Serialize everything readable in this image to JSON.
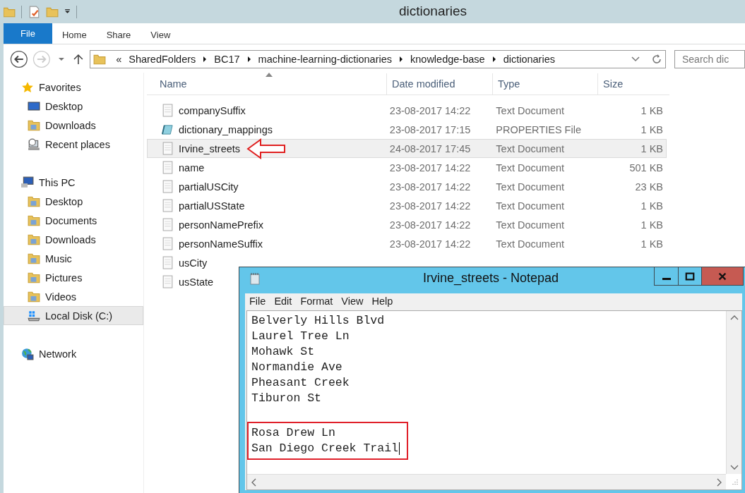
{
  "window": {
    "title": "dictionaries"
  },
  "quick_access": [
    {
      "kind": "folder"
    },
    {
      "kind": "properties"
    },
    {
      "kind": "folder"
    },
    {
      "kind": "dropdown"
    }
  ],
  "ribbon_tabs": [
    {
      "label": "File",
      "selected": true
    },
    {
      "label": "Home",
      "selected": false
    },
    {
      "label": "Share",
      "selected": false
    },
    {
      "label": "View",
      "selected": false
    }
  ],
  "address_bar": {
    "overflow": "«",
    "segments": [
      "SharedFolders",
      "BC17",
      "machine-learning-dictionaries",
      "knowledge-base",
      "dictionaries"
    ]
  },
  "search": {
    "placeholder": "Search dic"
  },
  "sidebar": {
    "items": [
      {
        "label": "Favorites",
        "kind": "star",
        "selected": false,
        "children": [
          {
            "label": "Desktop",
            "kind": "monitor",
            "selected": false
          },
          {
            "label": "Downloads",
            "kind": "folder",
            "selected": false
          },
          {
            "label": "Recent places",
            "kind": "recent",
            "selected": false
          }
        ]
      },
      {
        "label": "This PC",
        "kind": "computer",
        "selected": false,
        "children": [
          {
            "label": "Desktop",
            "kind": "folder",
            "selected": false
          },
          {
            "label": "Documents",
            "kind": "folder",
            "selected": false
          },
          {
            "label": "Downloads",
            "kind": "folder",
            "selected": false
          },
          {
            "label": "Music",
            "kind": "folder",
            "selected": false
          },
          {
            "label": "Pictures",
            "kind": "folder",
            "selected": false
          },
          {
            "label": "Videos",
            "kind": "folder",
            "selected": false
          },
          {
            "label": "Local Disk (C:)",
            "kind": "drive",
            "selected": true
          }
        ]
      },
      {
        "label": "Network",
        "kind": "globe",
        "selected": false
      }
    ]
  },
  "table": {
    "columns": [
      "Name",
      "Date modified",
      "Type",
      "Size"
    ],
    "rows": [
      {
        "kind": "text",
        "name": "companySuffix",
        "date": "23-08-2017 14:22",
        "type": "Text Document",
        "size": "1 KB",
        "selected": false
      },
      {
        "kind": "properties",
        "name": "dictionary_mappings",
        "date": "23-08-2017 17:15",
        "type": "PROPERTIES File",
        "size": "1 KB",
        "selected": false
      },
      {
        "kind": "text",
        "name": "Irvine_streets",
        "date": "24-08-2017 17:45",
        "type": "Text Document",
        "size": "1 KB",
        "selected": true,
        "pointer": true
      },
      {
        "kind": "text",
        "name": "name",
        "date": "23-08-2017 14:22",
        "type": "Text Document",
        "size": "501 KB",
        "selected": false
      },
      {
        "kind": "text",
        "name": "partialUSCity",
        "date": "23-08-2017 14:22",
        "type": "Text Document",
        "size": "23 KB",
        "selected": false
      },
      {
        "kind": "text",
        "name": "partialUSState",
        "date": "23-08-2017 14:22",
        "type": "Text Document",
        "size": "1 KB",
        "selected": false
      },
      {
        "kind": "text",
        "name": "personNamePrefix",
        "date": "23-08-2017 14:22",
        "type": "Text Document",
        "size": "1 KB",
        "selected": false
      },
      {
        "kind": "text",
        "name": "personNameSuffix",
        "date": "23-08-2017 14:22",
        "type": "Text Document",
        "size": "1 KB",
        "selected": false
      },
      {
        "kind": "text",
        "name": "usCity",
        "selected": false
      },
      {
        "kind": "text",
        "name": "usState",
        "selected": false
      }
    ]
  },
  "notepad": {
    "title": "Irvine_streets - Notepad",
    "menu": [
      "File",
      "Edit",
      "Format",
      "View",
      "Help"
    ],
    "blocks": [
      {
        "highlighted": false,
        "lines": [
          "Belverly Hills Blvd",
          "Laurel Tree Ln",
          "Mohawk St",
          "Normandie Ave",
          "Pheasant Creek",
          "Tiburon St"
        ]
      },
      {
        "highlighted": true,
        "lines": [
          "Rosa Drew Ln",
          "San Diego Creek Trail"
        ]
      }
    ]
  }
}
